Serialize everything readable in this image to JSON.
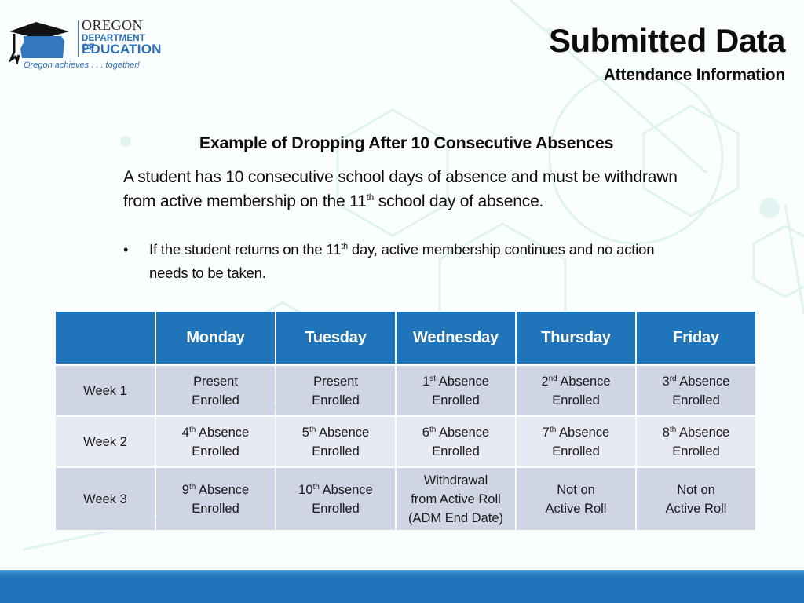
{
  "header": {
    "logo": {
      "name_line1": "OREGON",
      "name_line2": "DEPARTMENT OF",
      "name_line3": "EDUCATION",
      "tagline": "Oregon achieves . . . together!",
      "icon": "oregon-graduation-cap-icon",
      "brand_color": "#2c6fb7"
    },
    "title": "Submitted Data",
    "subtitle": "Attendance Information"
  },
  "content": {
    "heading": "Example of Dropping After 10 Consecutive Absences",
    "paragraph": {
      "part1": "A student has 10 consecutive school days of absence and must be withdrawn from active membership on the 11",
      "sup": "th",
      "part2": " school day of absence."
    },
    "bullet": {
      "marker": "•",
      "part1": "If the student returns on the 11",
      "sup": "th",
      "part2": " day, active membership continues and no action needs to be taken."
    }
  },
  "table": {
    "header_color": "#1f74ba",
    "columns": [
      "",
      "Monday",
      "Tuesday",
      "Wednesday",
      "Thursday",
      "Friday"
    ],
    "rows": [
      {
        "label": "Week 1",
        "cells": [
          {
            "num": "",
            "sup": "",
            "line1": "Present",
            "line2": "Enrolled",
            "line3": ""
          },
          {
            "num": "",
            "sup": "",
            "line1": "Present",
            "line2": "Enrolled",
            "line3": ""
          },
          {
            "num": "1",
            "sup": "st",
            "line1": " Absence",
            "line2": "Enrolled",
            "line3": ""
          },
          {
            "num": "2",
            "sup": "nd",
            "line1": " Absence",
            "line2": "Enrolled",
            "line3": ""
          },
          {
            "num": "3",
            "sup": "rd",
            "line1": " Absence",
            "line2": "Enrolled",
            "line3": ""
          }
        ]
      },
      {
        "label": "Week 2",
        "cells": [
          {
            "num": "4",
            "sup": "th",
            "line1": " Absence",
            "line2": "Enrolled",
            "line3": ""
          },
          {
            "num": "5",
            "sup": "th",
            "line1": " Absence",
            "line2": "Enrolled",
            "line3": ""
          },
          {
            "num": "6",
            "sup": "th",
            "line1": " Absence",
            "line2": "Enrolled",
            "line3": ""
          },
          {
            "num": "7",
            "sup": "th",
            "line1": " Absence",
            "line2": "Enrolled",
            "line3": ""
          },
          {
            "num": "8",
            "sup": "th",
            "line1": " Absence",
            "line2": "Enrolled",
            "line3": ""
          }
        ]
      },
      {
        "label": "Week 3",
        "cells": [
          {
            "num": "9",
            "sup": "th",
            "line1": " Absence",
            "line2": "Enrolled",
            "line3": ""
          },
          {
            "num": "10",
            "sup": "th",
            "line1": " Absence",
            "line2": "Enrolled",
            "line3": ""
          },
          {
            "num": "",
            "sup": "",
            "line1": "Withdrawal",
            "line2": "from Active Roll",
            "line3": "(ADM End Date)"
          },
          {
            "num": "",
            "sup": "",
            "line1": "Not on",
            "line2": "Active Roll",
            "line3": ""
          },
          {
            "num": "",
            "sup": "",
            "line1": "Not on",
            "line2": "Active Roll",
            "line3": ""
          }
        ]
      }
    ]
  },
  "footer": {
    "bar_color": "#1f74ba"
  }
}
